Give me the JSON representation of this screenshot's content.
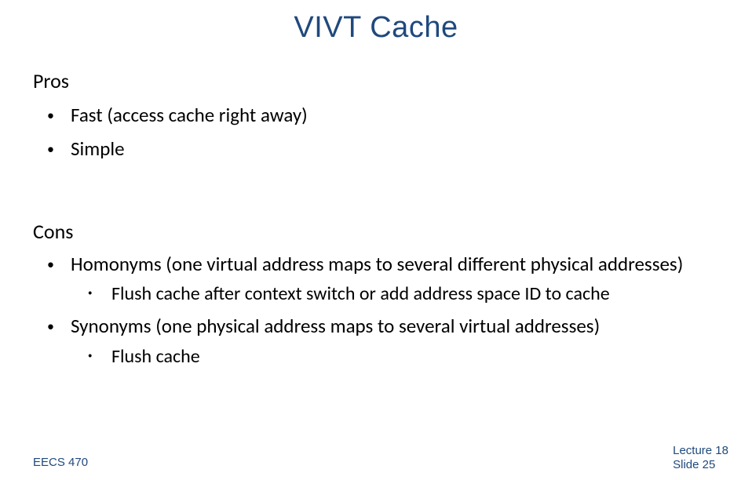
{
  "title": "VIVT Cache",
  "pros": {
    "heading": "Pros",
    "items": [
      "Fast (access cache right away)",
      "Simple"
    ]
  },
  "cons": {
    "heading": "Cons",
    "items": [
      {
        "text": "Homonyms (one virtual address maps to several different physical addresses)",
        "sub": [
          "Flush cache after context switch or add address space ID to cache"
        ]
      },
      {
        "text": "Synonyms (one physical address maps to several virtual addresses)",
        "sub": [
          "Flush cache"
        ]
      }
    ]
  },
  "footer": {
    "course": "EECS 470",
    "lecture": "Lecture 18",
    "slide": "Slide 25"
  }
}
